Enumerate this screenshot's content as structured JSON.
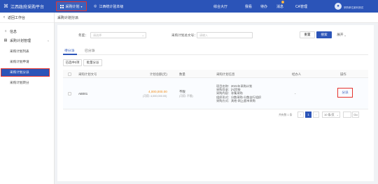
{
  "app": {
    "title": "江西政府采购平台",
    "module_label": "采购计划",
    "region_label": "江西统计验本级"
  },
  "topnav": {
    "items": [
      "综合大厅",
      "我看",
      "待办",
      "消息",
      "CA管理"
    ],
    "message_badge": "1",
    "username": "采购单位某科测试"
  },
  "sidebar": {
    "back_label": "返回工作台",
    "items": [
      {
        "label": "信息"
      },
      {
        "label": "采购计划管理"
      }
    ],
    "sub_items": [
      {
        "label": "采购计划列表"
      },
      {
        "label": "采购计划申请"
      },
      {
        "label": "采购计划分派"
      },
      {
        "label": "采购计划转分"
      }
    ]
  },
  "page_tab": {
    "label": "采购计划分派"
  },
  "filters": {
    "year_label": "年度：",
    "year_placeholder": "请选择",
    "plan_no_label": "采购计划总文号：",
    "plan_no_placeholder": "请输入",
    "reset_label": "重置",
    "search_label": "搜索",
    "expand_label": "展开"
  },
  "subtabs": [
    {
      "label": "待分派"
    },
    {
      "label": "已分派"
    }
  ],
  "actions": {
    "selected_label": "已选中0项",
    "batch_label": "批量分派"
  },
  "table": {
    "headers": [
      "采购计划文号",
      "计划总额(元)",
      "数量",
      "采购计划信息",
      "经办人",
      "操作"
    ],
    "rows": [
      {
        "plan_no": "AB001",
        "amount": "4,000,000.00",
        "amount_sub": "(可用: 4,000,000.00)",
        "quantity": "不限",
        "quantity_sub": "(可用: 不限)",
        "info": [
          "项目名称：2021年采购计划",
          "采购目录：[A]货物",
          "采购内容：非集采购",
          "组织形式：分散采购-分散自行组织",
          "采购方式：其他-网上超市采购"
        ],
        "handler": "-",
        "op_label": "分派"
      }
    ]
  },
  "pager": {
    "total_label": "共有数 1 条",
    "prev": "‹",
    "current": "1",
    "next": "›",
    "page_size": "10 条/页",
    "go_label": "Go"
  },
  "colors": {
    "primary": "#2b54b8",
    "highlight_border": "#e5322d",
    "amount": "#f08c19"
  }
}
